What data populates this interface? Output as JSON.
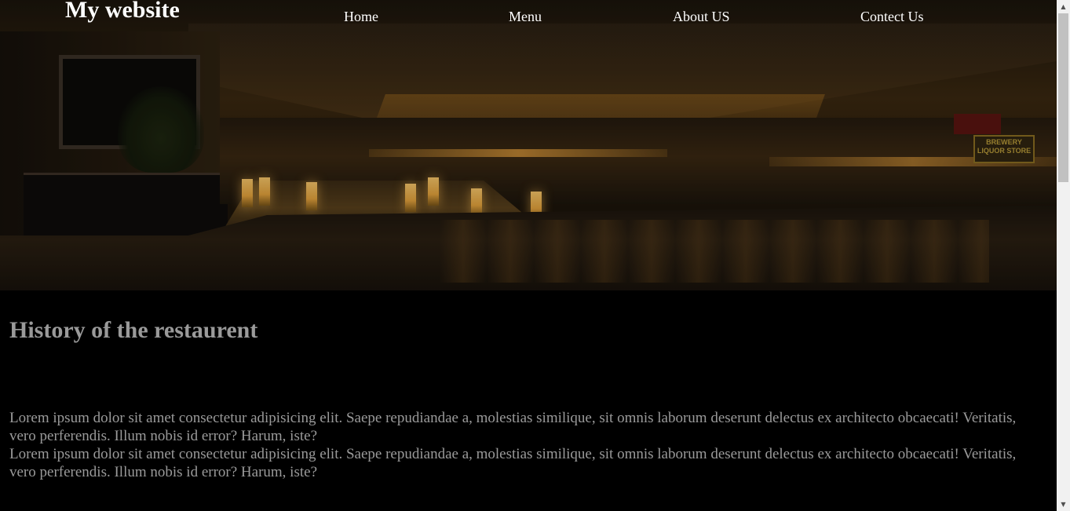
{
  "header": {
    "logo": "My website",
    "nav": [
      {
        "label": "Home"
      },
      {
        "label": "Menu"
      },
      {
        "label": "About US"
      },
      {
        "label": "Contect Us"
      }
    ]
  },
  "hero": {
    "store_sign": "BREWERY LIQUOR STORE"
  },
  "main": {
    "title": "History of the restaurent",
    "paragraphs": [
      "Lorem ipsum dolor sit amet consectetur adipisicing elit. Saepe repudiandae a, molestias similique, sit omnis laborum deserunt delectus ex architecto obcaecati! Veritatis, vero perferendis. Illum nobis id error? Harum, iste?",
      "Lorem ipsum dolor sit amet consectetur adipisicing elit. Saepe repudiandae a, molestias similique, sit omnis laborum deserunt delectus ex architecto obcaecati! Veritatis, vero perferendis. Illum nobis id error? Harum, iste?"
    ]
  },
  "scrollbar": {
    "up_icon": "▲",
    "down_icon": "▼"
  },
  "colors": {
    "page_background": "#000000",
    "text_muted": "#9a9a9a",
    "nav_text": "#ffffff"
  }
}
